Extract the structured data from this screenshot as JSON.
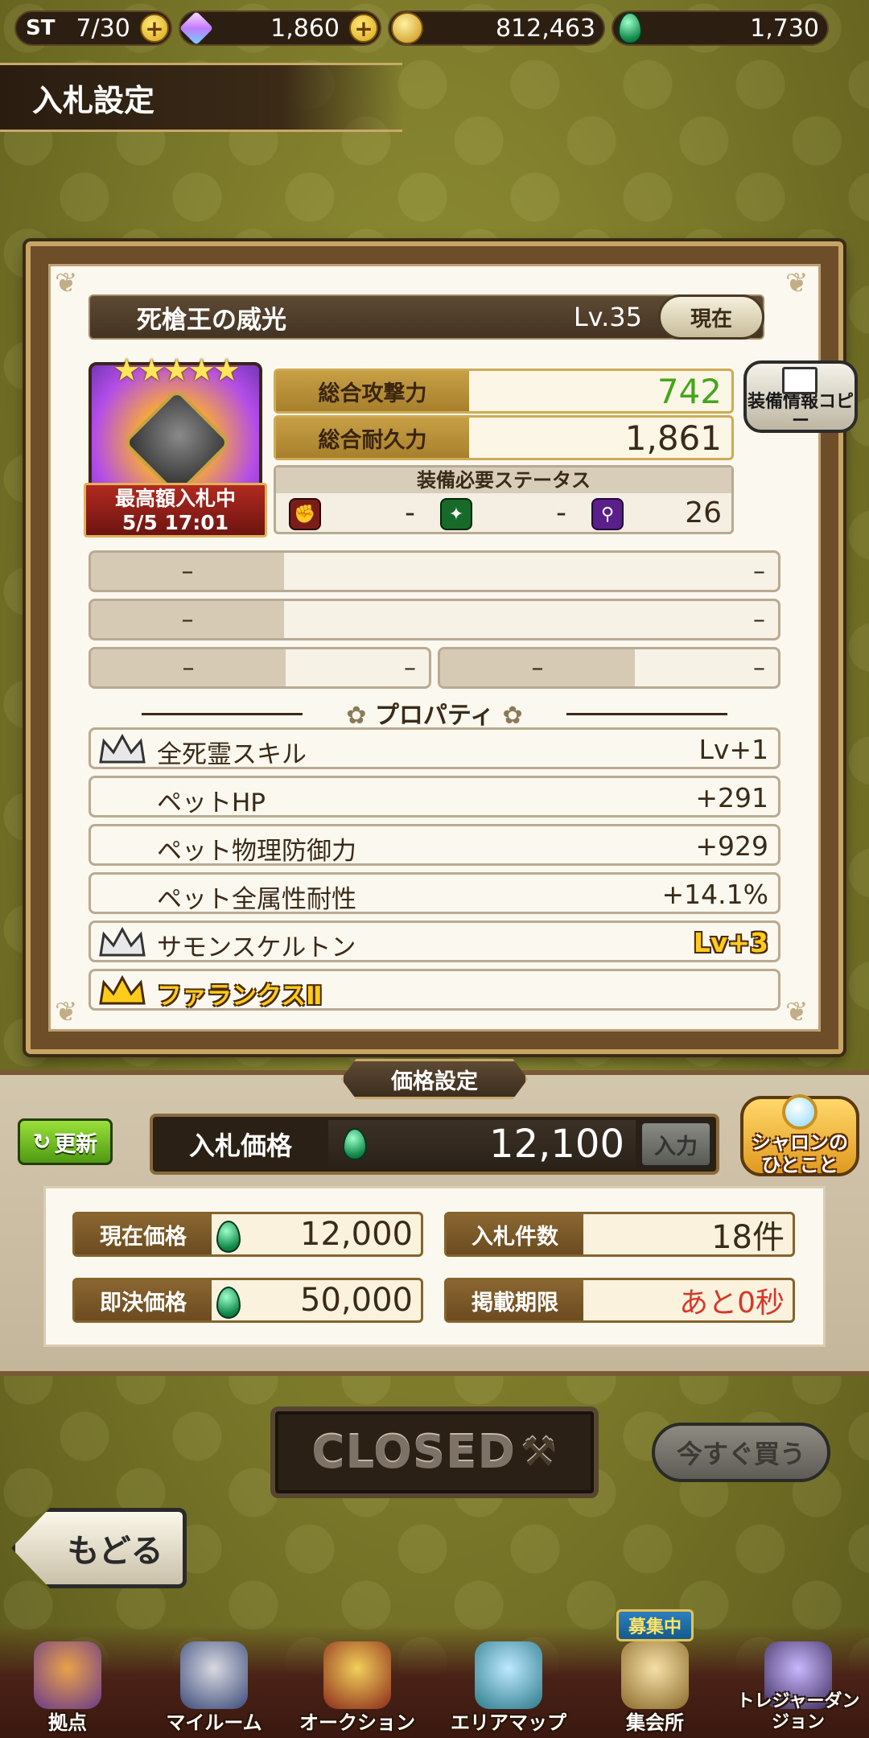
{
  "topbar": {
    "stamina_label": "ST",
    "stamina": "7/30",
    "gems": "1,860",
    "gold": "812,463",
    "emeralds": "1,730"
  },
  "header": {
    "title": "入札設定"
  },
  "item": {
    "name": "死槍王の威光",
    "level": "Lv.35",
    "now_button": "現在",
    "stars": "★★★★★",
    "bid_status": "最高額入札中",
    "bid_time": "5/5 17:01",
    "attack_label": "総合攻撃力",
    "attack": "742",
    "durability_label": "総合耐久力",
    "durability": "1,861",
    "req_title": "装備必要ステータス",
    "req_str": "-",
    "req_dex": "-",
    "req_mag": "26",
    "copy_button": "装備情報コピー"
  },
  "substats": [
    {
      "left": "–",
      "right": "–"
    },
    {
      "left": "–",
      "right": "–"
    },
    {
      "left": "–",
      "right": "–"
    },
    {
      "left": "–",
      "right": "–"
    }
  ],
  "properties_title": "プロパティ",
  "properties": [
    {
      "name": "全死霊スキル",
      "value": "Lv+1",
      "icon": "crown-silver-icon"
    },
    {
      "name": "ペットHP",
      "value": "+291",
      "icon": ""
    },
    {
      "name": "ペット物理防御力",
      "value": "+929",
      "icon": ""
    },
    {
      "name": "ペット全属性耐性",
      "value": "+14.1%",
      "icon": ""
    },
    {
      "name": "サモンスケルトン",
      "value": "Lv+3",
      "icon": "crown-silver-icon"
    },
    {
      "name": "ファランクスⅡ",
      "value": "",
      "icon": "crown-gold-icon"
    }
  ],
  "price": {
    "section_title": "価格設定",
    "refresh_button": "更新",
    "bid_label": "入札価格",
    "bid_value": "12,100",
    "input_button": "入力",
    "sharon_line1": "シャロンの",
    "sharon_line2": "ひとこと",
    "current_label": "現在価格",
    "current_value": "12,000",
    "bids_label": "入札件数",
    "bids_value": "18件",
    "buyout_label": "即決価格",
    "buyout_value": "50,000",
    "deadline_label": "掲載期限",
    "deadline_value": "あと0秒"
  },
  "actions": {
    "closed": "CLOSED",
    "buy_now": "今すぐ買う",
    "back": "もどる"
  },
  "nav": {
    "recruit_badge": "募集中",
    "items": [
      {
        "label": "拠点"
      },
      {
        "label": "マイルーム"
      },
      {
        "label": "オークション"
      },
      {
        "label": "エリアマップ"
      },
      {
        "label": "集会所"
      },
      {
        "label": "トレジャーダンジョン"
      }
    ]
  },
  "colors": {
    "accent_gold": "#c79f45",
    "attack_green": "#45a51c",
    "deadline_red": "#d6372a"
  }
}
